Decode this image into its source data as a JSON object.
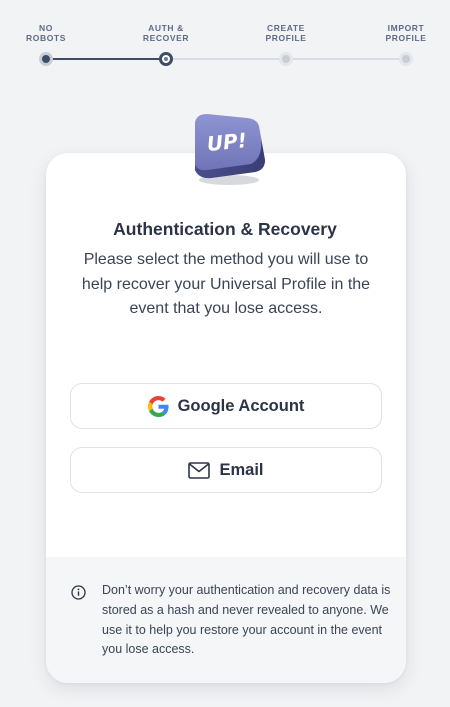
{
  "stepper": {
    "steps": [
      {
        "label": "NO\nROBOTS",
        "state": "done"
      },
      {
        "label": "AUTH &\nRECOVER",
        "state": "current"
      },
      {
        "label": "CREATE\nPROFILE",
        "state": "todo"
      },
      {
        "label": "IMPORT\nPROFILE",
        "state": "todo"
      }
    ]
  },
  "logo": {
    "text": "UP!",
    "icon": "up-cube-logo"
  },
  "card": {
    "title": "Authentication & Recovery",
    "description": "Please select the method you will use to help recover your Universal Profile in the event that you lose access.",
    "buttons": {
      "google_label": "Google Account",
      "google_icon": "google-g-icon",
      "email_label": "Email",
      "email_icon": "envelope-icon"
    },
    "info": {
      "icon": "info-circle-icon",
      "text": "Don’t worry your authentication and recovery data is stored as a hash and never revealed to anyone. We use it to help you restore your account in the event you lose access."
    }
  },
  "colors": {
    "background": "#f2f3f5",
    "accent": "#3e4c66",
    "logo": "#6e75b8"
  }
}
